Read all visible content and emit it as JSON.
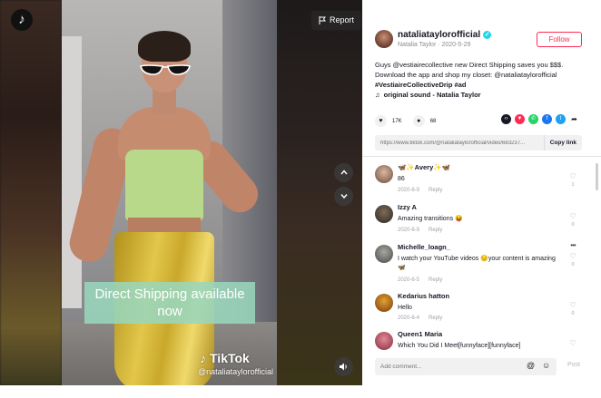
{
  "video": {
    "caption_line1": "Direct Shipping available",
    "caption_line2": "now",
    "report_label": "Report",
    "watermark_brand": "TikTok",
    "watermark_handle": "@nataliataylorofficial",
    "icons": {
      "logo": "tiktok-logo-icon",
      "report": "flag-icon",
      "up": "chevron-up-icon",
      "down": "chevron-down-icon",
      "mute": "speaker-icon"
    }
  },
  "post": {
    "username": "nataliataylorofficial",
    "display_name_date": "Natalia Taylor · 2020-5-29",
    "follow_label": "Follow",
    "description": "Guys @vestiairecollective new Direct Shipping saves you $$$. Download the app and shop my closet: @nataliataylorofficial",
    "hashtags": "#VestiaireCollectiveDrip #ad",
    "sound": "original sound - Natalia Taylor",
    "likes": "17K",
    "comments_count": "68",
    "link": "https://www.tiktok.com/@nataliataylorofficial/video/683237...",
    "copy_link_label": "Copy link",
    "share_icons": [
      "embed-icon",
      "share-red-icon",
      "whatsapp-icon",
      "facebook-icon",
      "twitter-icon",
      "forward-icon"
    ],
    "accent_color": "#fe2c55"
  },
  "comments": [
    {
      "name": "🦋✨Avery✨🦋",
      "text": "86",
      "date": "2020-6-9",
      "reply": "Reply",
      "likes": "1"
    },
    {
      "name": "Izzy A",
      "text": "Amazing transitions 😝",
      "date": "2020-6-9",
      "reply": "Reply",
      "likes": "0"
    },
    {
      "name": "Michelle_loagn_",
      "text": "I watch your YouTube videos 😔your content is amazing 🦋",
      "date": "2020-6-5",
      "reply": "Reply",
      "likes": "0"
    },
    {
      "name": "Kedarius hatton",
      "text": "Hello",
      "date": "2020-6-4",
      "reply": "Reply",
      "likes": "0"
    },
    {
      "name": "Queen1 Maria",
      "text": "Which You Did I Meet[funnyface][funnyface]",
      "date": "",
      "reply": "",
      "likes": ""
    }
  ],
  "composer": {
    "placeholder": "Add comment...",
    "post_label": "Post"
  }
}
